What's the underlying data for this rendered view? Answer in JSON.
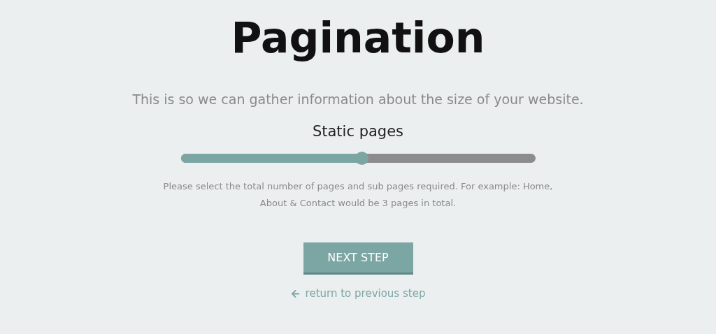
{
  "title": "Pagination",
  "subtitle": "This is so we can gather information about the size of your website.",
  "slider": {
    "label": "Static pages",
    "level": 0.51
  },
  "help": "Please select the total number of pages and sub pages required. For example: Home, About & Contact would be 3 pages in total.",
  "next_button": "NEXT STEP",
  "back_link": "return to previous step"
}
